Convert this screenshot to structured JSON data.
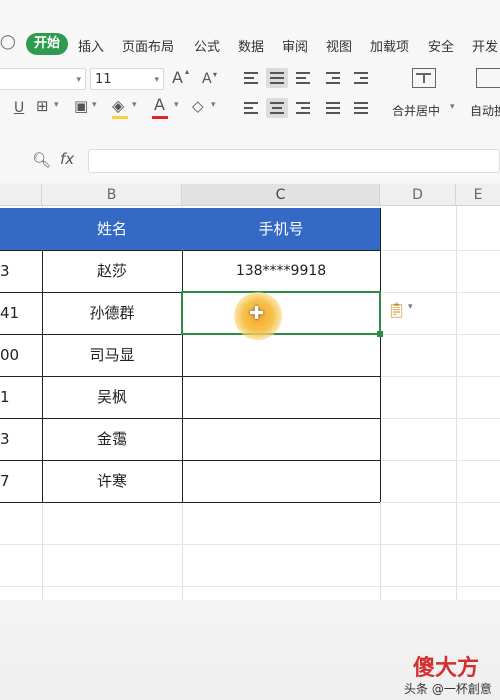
{
  "menu": {
    "tabs": [
      "开始",
      "插入",
      "页面布局",
      "公式",
      "数据",
      "审阅",
      "视图",
      "加载项",
      "安全",
      "开发"
    ]
  },
  "ribbon": {
    "font_size": "11",
    "merge_label": "合并居中",
    "autofit_label": "自动换"
  },
  "formula_bar": {
    "fx_label": "fx",
    "value": ""
  },
  "sheet": {
    "columns": [
      "B",
      "C",
      "D",
      "E"
    ],
    "headers": {
      "name": "姓名",
      "phone": "手机号"
    },
    "rows": [
      {
        "a_partial": "3",
        "name": "赵莎",
        "phone": "138****9918"
      },
      {
        "a_partial": "41",
        "name": "孙德群",
        "phone": ""
      },
      {
        "a_partial": "00",
        "name": "司马显",
        "phone": ""
      },
      {
        "a_partial": "1",
        "name": "吴枫",
        "phone": ""
      },
      {
        "a_partial": "3",
        "name": "金霭",
        "phone": ""
      },
      {
        "a_partial": "7",
        "name": "许寒",
        "phone": ""
      }
    ]
  },
  "watermark": {
    "brand": "傻大方",
    "caption": "头条 @一杯創意"
  },
  "colors": {
    "accent_green": "#2e9b4f",
    "header_blue": "#3469c6",
    "selection_green": "#2e8b45",
    "cursor_glow": "#f5c842"
  }
}
